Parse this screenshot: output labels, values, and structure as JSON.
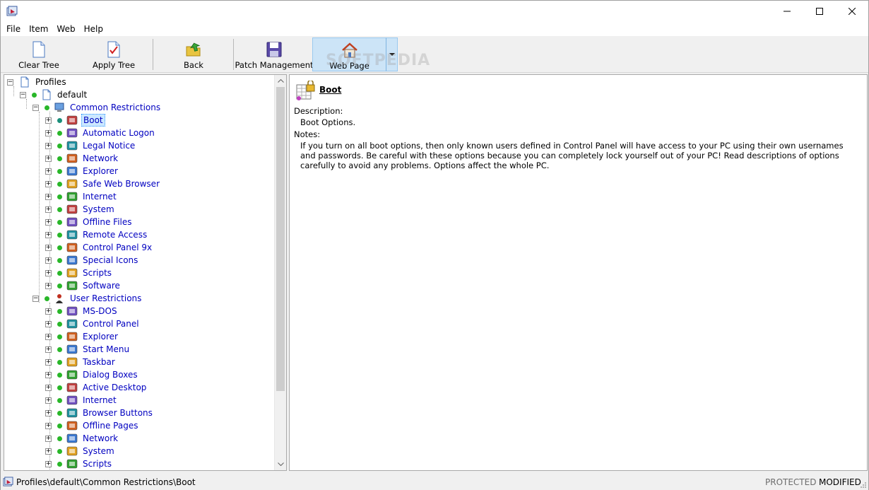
{
  "menu": [
    "File",
    "Item",
    "Web",
    "Help"
  ],
  "toolbar": {
    "clear_tree": "Clear Tree",
    "apply_tree": "Apply Tree",
    "back": "Back",
    "patch_management": "Patch Management",
    "web_page": "Web Page"
  },
  "watermark": "SOFTPEDIA",
  "tree": {
    "root": "Profiles",
    "profile": "default",
    "common_group": "Common Restrictions",
    "common_items": [
      "Boot",
      "Automatic Logon",
      "Legal Notice",
      "Network",
      "Explorer",
      "Safe Web Browser",
      "Internet",
      "System",
      "Offline Files",
      "Remote Access",
      "Control Panel 9x",
      "Special Icons",
      "Scripts",
      "Software"
    ],
    "user_group": "User Restrictions",
    "user_items": [
      "MS-DOS",
      "Control Panel",
      "Explorer",
      "Start Menu",
      "Taskbar",
      "Dialog Boxes",
      "Active Desktop",
      "Internet",
      "Browser Buttons",
      "Offline Pages",
      "Network",
      "System",
      "Scripts"
    ]
  },
  "detail": {
    "title": "Boot",
    "description_label": "Description:",
    "description": "Boot Options.",
    "notes_label": "Notes:",
    "notes": "If you turn on all boot options, then only known users defined in Control Panel will have access to your PC using their own usernames and passwords. Be careful with these options because you can completely lock yourself out of your PC! Read descriptions of options carefully to avoid any problems. Options affect the whole PC."
  },
  "status": {
    "path": "Profiles\\default\\Common Restrictions\\Boot",
    "protected": "PROTECTED",
    "modified": "MODIFIED"
  },
  "colors": {
    "link": "#0000c0",
    "dot_green": "#29b729",
    "selection": "#cce8ff",
    "toolbar_active": "#cce4f7"
  }
}
